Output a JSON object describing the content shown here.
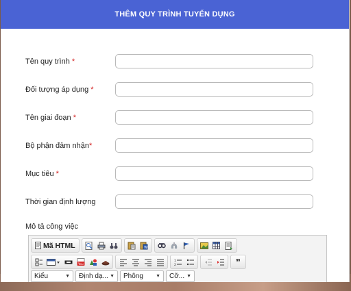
{
  "header": {
    "title": "THÊM QUY TRÌNH TUYỂN DỤNG"
  },
  "form": {
    "fields": [
      {
        "label": "Tên quy trình",
        "required_mark": " *",
        "value": ""
      },
      {
        "label": "Đối tượng áp dụng",
        "required_mark": " *",
        "value": ""
      },
      {
        "label": "Tên giai đoạn",
        "required_mark": " *",
        "value": ""
      },
      {
        "label": "Bộ phận đảm nhận",
        "required_mark": "*",
        "value": ""
      },
      {
        "label": "Mục tiêu",
        "required_mark": " *",
        "value": ""
      },
      {
        "label": "Thời gian định lượng",
        "required_mark": "",
        "value": ""
      }
    ],
    "description_label": "Mô tả công việc"
  },
  "editor": {
    "source_label": "Mã HTML",
    "combos": {
      "style": "Kiểu",
      "format": "Định dạ...",
      "font": "Phông",
      "size": "Cỡ..."
    }
  },
  "colors": {
    "header_bg": "#4a63d4",
    "required": "#d21d1d"
  }
}
